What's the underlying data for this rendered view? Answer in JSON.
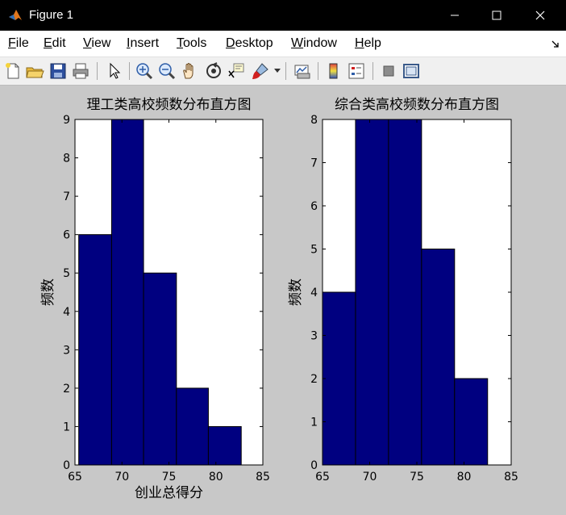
{
  "window": {
    "title": "Figure 1"
  },
  "menu": [
    {
      "label": "File",
      "ul": "F",
      "rest": "ile"
    },
    {
      "label": "Edit",
      "ul": "E",
      "rest": "dit"
    },
    {
      "label": "View",
      "ul": "V",
      "rest": "iew"
    },
    {
      "label": "Insert",
      "ul": "I",
      "rest": "nsert"
    },
    {
      "label": "Tools",
      "ul": "T",
      "rest": "ools"
    },
    {
      "label": "Desktop",
      "ul": "D",
      "rest": "esktop"
    },
    {
      "label": "Window",
      "ul": "W",
      "rest": "indow"
    },
    {
      "label": "Help",
      "ul": "H",
      "rest": "elp"
    }
  ],
  "toolbar_icons": [
    "new-figure-icon",
    "open-file-icon",
    "save-icon",
    "print-icon",
    "pointer-icon",
    "zoom-in-icon",
    "zoom-out-icon",
    "pan-hand-icon",
    "rotate-3d-icon",
    "data-cursor-icon",
    "brush-icon",
    "link-plot-icon",
    "colorbar-icon",
    "legend-icon",
    "hide-plot-tools-icon",
    "show-plot-tools-icon"
  ],
  "colors": {
    "bar_fill": "#000080",
    "bar_edge": "#000000",
    "figure_bg": "#c8c8c8"
  },
  "chart_data": [
    {
      "type": "bar",
      "title": "理工类高校频数分布直方图",
      "xlabel": "创业总得分",
      "ylabel": "频数",
      "bin_edges": [
        65.4,
        68.9,
        72.3,
        75.8,
        79.2,
        82.7
      ],
      "values": [
        6,
        9,
        5,
        2,
        1
      ],
      "xlim": [
        65,
        85
      ],
      "ylim": [
        0,
        9
      ],
      "xticks": [
        65,
        70,
        75,
        80,
        85
      ],
      "yticks": [
        0,
        1,
        2,
        3,
        4,
        5,
        6,
        7,
        8,
        9
      ],
      "grid": false
    },
    {
      "type": "bar",
      "title": "综合类高校频数分布直方图",
      "xlabel": "",
      "ylabel": "频数",
      "bin_edges": [
        65.0,
        68.5,
        72.0,
        75.5,
        79.0,
        82.5
      ],
      "values": [
        4,
        8,
        8,
        5,
        2
      ],
      "xlim": [
        65,
        85
      ],
      "ylim": [
        0,
        8
      ],
      "xticks": [
        65,
        70,
        75,
        80,
        85
      ],
      "yticks": [
        0,
        1,
        2,
        3,
        4,
        5,
        6,
        7,
        8
      ],
      "grid": false
    }
  ]
}
